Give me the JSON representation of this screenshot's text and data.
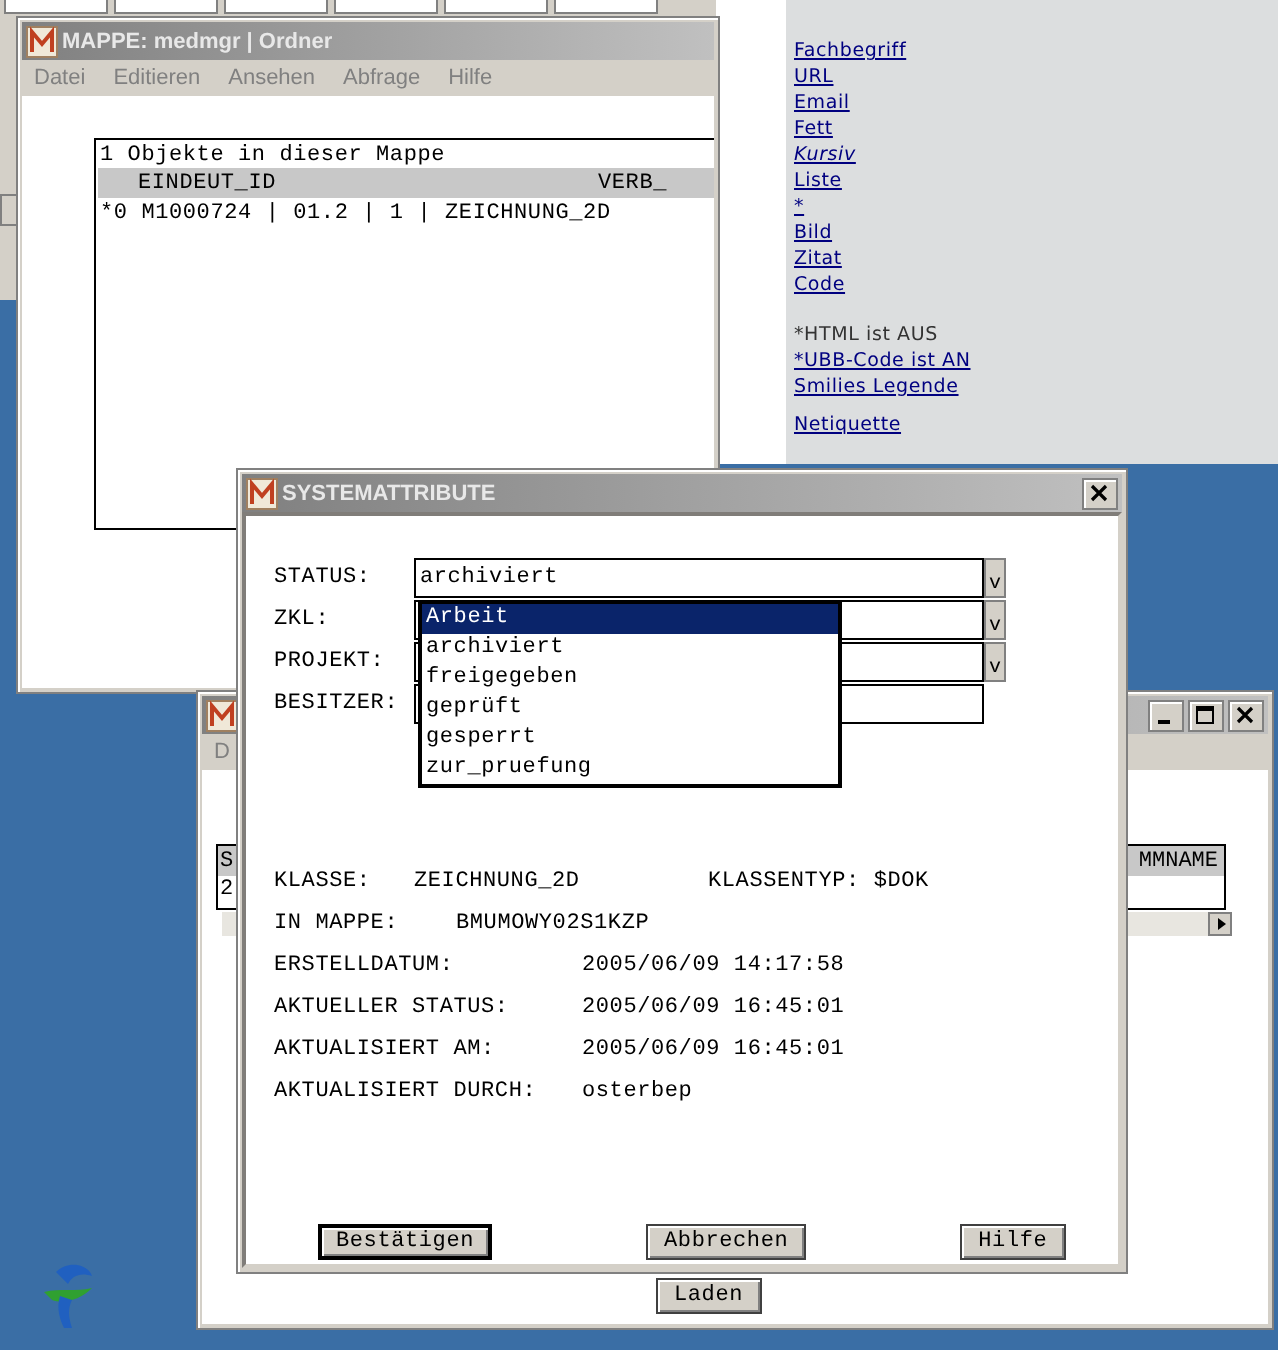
{
  "help_panel": {
    "sections": [
      {
        "items": [
          {
            "text": "Fachbegriff",
            "kind": "link"
          },
          {
            "text": "URL",
            "kind": "link"
          },
          {
            "text": "Email",
            "kind": "link"
          },
          {
            "text": "Fett",
            "kind": "link"
          },
          {
            "text": "Kursiv",
            "kind": "italic-link"
          },
          {
            "text": "Liste",
            "kind": "link"
          },
          {
            "text": "*",
            "kind": "link"
          },
          {
            "text": "Bild",
            "kind": "link"
          },
          {
            "text": "Zitat",
            "kind": "link"
          },
          {
            "text": "Code",
            "kind": "link"
          }
        ]
      },
      {
        "items": [
          {
            "text": "*HTML ist AUS",
            "kind": "note"
          },
          {
            "text": "*UBB-Code ist AN",
            "kind": "link"
          },
          {
            "text": "Smilies Legende",
            "kind": "link"
          }
        ]
      },
      {
        "items": [
          {
            "text": "Netiquette",
            "kind": "link"
          }
        ]
      }
    ]
  },
  "mappe_window": {
    "title": "MAPPE: medmgr | Ordner",
    "menu": [
      "Datei",
      "Editieren",
      "Ansehen",
      "Abfrage",
      "Hilfe"
    ],
    "table": {
      "caption": "1 Objekte in dieser Mappe",
      "columns": [
        "EINDEUT_ID",
        "VERB_"
      ],
      "rows": [
        "*0 M1000724 | 01.2 | 1 | ZEICHNUNG_2D"
      ]
    }
  },
  "back_window": {
    "menu": [
      "D"
    ],
    "table": {
      "columns": [
        "S",
        "MMNAME"
      ],
      "rows": [
        "2"
      ]
    },
    "button": "Laden"
  },
  "dialog": {
    "title": "SYSTEMATTRIBUTE",
    "fields": [
      {
        "label": "STATUS:",
        "value": "archiviert",
        "kind": "combo",
        "button": "v"
      },
      {
        "label": "ZKL:",
        "kind": "combo",
        "button": "v"
      },
      {
        "label": "PROJEKT:",
        "kind": "combo",
        "button": "v"
      },
      {
        "label": "BESITZER:",
        "kind": "text"
      }
    ],
    "dropdown": [
      {
        "label": "Arbeit",
        "selected": true
      },
      {
        "label": "archiviert",
        "selected": false
      },
      {
        "label": "freigegeben",
        "selected": false
      },
      {
        "label": "geprüft",
        "selected": false
      },
      {
        "label": "gesperrt",
        "selected": false
      },
      {
        "label": "zur_pruefung",
        "selected": false
      }
    ],
    "class_row": {
      "label": "KLASSE:",
      "value": "ZEICHNUNG_2D",
      "type_label": "KLASSENTYP:",
      "type_value": "$DOK"
    },
    "folder_row": {
      "label": "IN MAPPE:",
      "value": "BMUMOWY02S1KZP"
    },
    "history": [
      {
        "label": "ERSTELLDATUM:",
        "value": "2005/06/09 14:17:58"
      },
      {
        "label": "AKTUELLER STATUS:",
        "value": "2005/06/09 16:45:01"
      },
      {
        "label": "AKTUALISIERT AM:",
        "value": "2005/06/09 16:45:01"
      },
      {
        "label": "AKTUALISIERT DURCH:",
        "value": "osterbep"
      }
    ],
    "buttons": [
      {
        "label": "Bestätigen",
        "default": true
      },
      {
        "label": "Abbrechen",
        "default": false
      },
      {
        "label": "Hilfe",
        "default": false
      }
    ]
  }
}
